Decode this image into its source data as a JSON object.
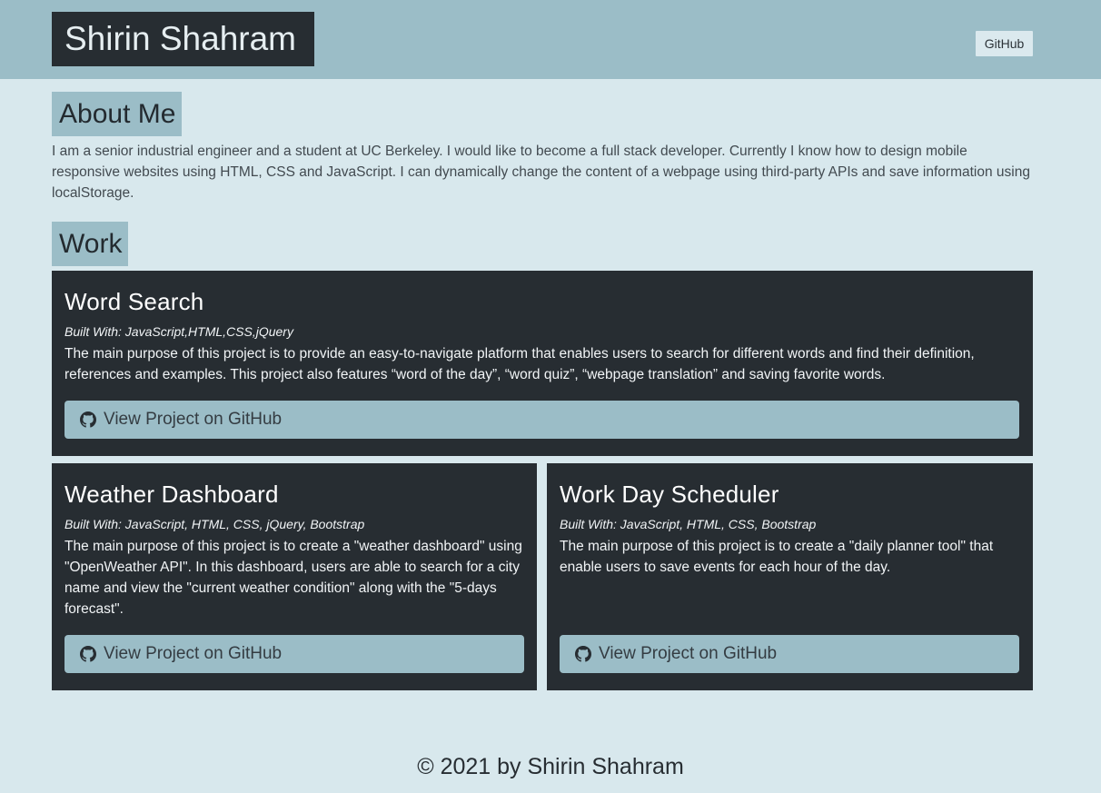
{
  "header": {
    "brand": "Shirin Shahram",
    "nav_link": "GitHub"
  },
  "about": {
    "heading": "About Me",
    "text": "I am a senior industrial engineer and a student at UC Berkeley. I would like to become a full stack developer. Currently I know how to design mobile responsive websites using HTML, CSS and JavaScript. I can dynamically change the content of a webpage using third-party APIs and save information using localStorage."
  },
  "work": {
    "heading": "Work",
    "projects": [
      {
        "title": "Word Search",
        "built_with": "Built With: JavaScript,HTML,CSS,jQuery",
        "description": "The main purpose of this project is to provide an easy-to-navigate platform that enables users to search for different words and find their definition, references and examples. This project also features “word of the day”, “word quiz”, “webpage translation” and saving favorite words.",
        "button": "View Project on GitHub",
        "icon": "github-icon"
      },
      {
        "title": "Weather Dashboard",
        "built_with": "Built With: JavaScript, HTML, CSS, jQuery, Bootstrap",
        "description": "The main purpose of this project is to create a \"weather dashboard\" using \"OpenWeather API\". In this dashboard, users are able to search for a city name and view the \"current weather condition\" along with the \"5-days forecast\".",
        "button": "View Project on GitHub",
        "icon": "github-icon"
      },
      {
        "title": "Work Day Scheduler",
        "built_with": "Built With: JavaScript, HTML, CSS, Bootstrap",
        "description": "The main purpose of this project is to create a \"daily planner tool\" that enable users to save events for each hour of the day.",
        "button": "View Project on GitHub",
        "icon": "github-icon"
      }
    ]
  },
  "footer": {
    "text": "© 2021 by Shirin Shahram"
  },
  "colors": {
    "background": "#d8e8ed",
    "accent": "#9bbdc7",
    "dark": "#272d32"
  }
}
